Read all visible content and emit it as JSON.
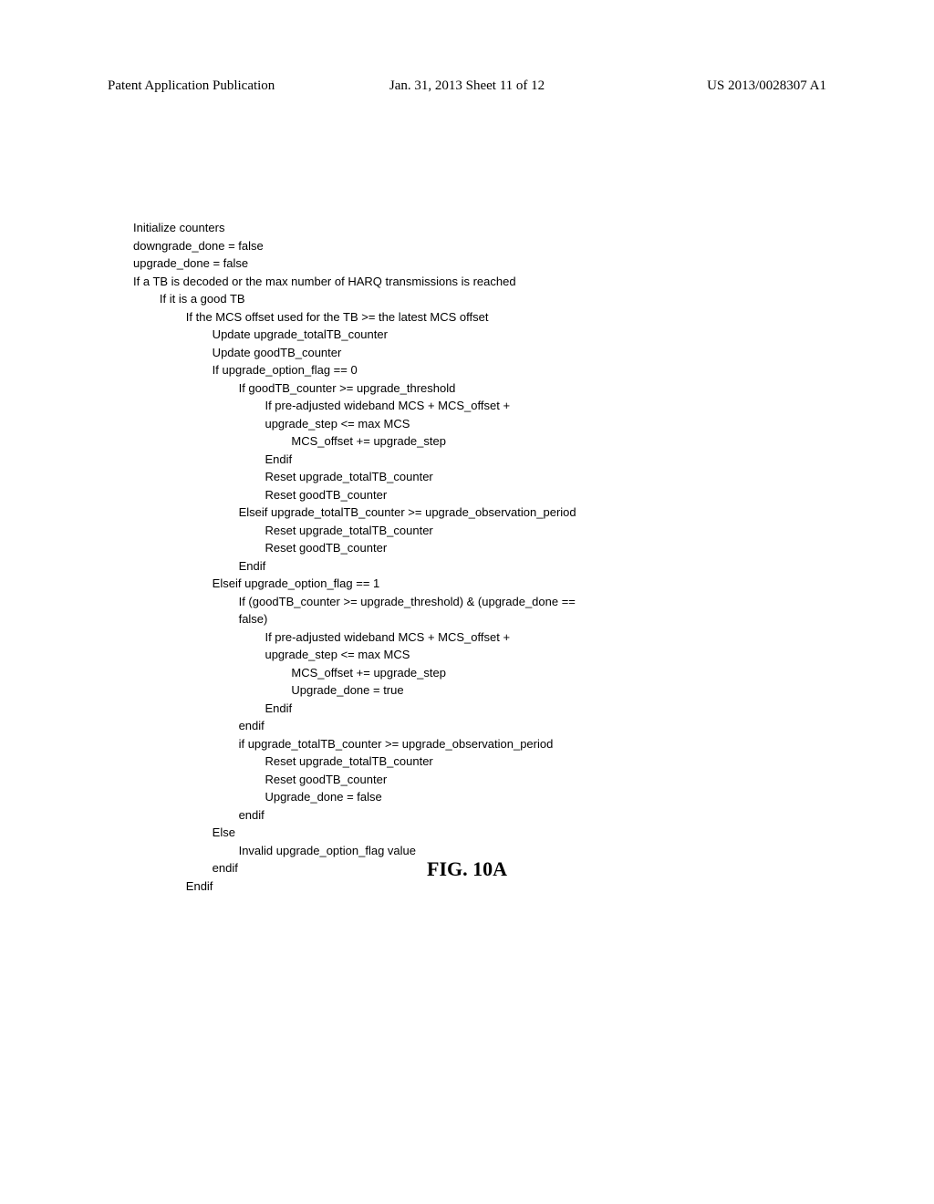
{
  "header": {
    "left": "Patent Application Publication",
    "center": "Jan. 31, 2013  Sheet 11 of 12",
    "right": "US 2013/0028307 A1"
  },
  "code": {
    "lines": [
      "Initialize counters",
      "downgrade_done = false",
      "upgrade_done = false",
      "If a TB is decoded or the max number of HARQ transmissions is reached",
      "        If it is a good TB",
      "                If the MCS offset used for the TB >= the latest MCS offset",
      "                        Update upgrade_totalTB_counter",
      "                        Update goodTB_counter",
      "                        If upgrade_option_flag == 0",
      "                                If goodTB_counter >= upgrade_threshold",
      "                                        If pre-adjusted wideband MCS + MCS_offset +",
      "                                        upgrade_step <= max MCS",
      "                                                MCS_offset += upgrade_step",
      "                                        Endif",
      "                                        Reset upgrade_totalTB_counter",
      "                                        Reset goodTB_counter",
      "                                Elseif upgrade_totalTB_counter >= upgrade_observation_period",
      "                                        Reset upgrade_totalTB_counter",
      "                                        Reset goodTB_counter",
      "                                Endif",
      "                        Elseif upgrade_option_flag == 1",
      "                                If (goodTB_counter >= upgrade_threshold) & (upgrade_done ==",
      "                                false)",
      "                                        If pre-adjusted wideband MCS + MCS_offset +",
      "                                        upgrade_step <= max MCS",
      "                                                MCS_offset += upgrade_step",
      "                                                Upgrade_done = true",
      "                                        Endif",
      "                                endif",
      "                                if upgrade_totalTB_counter >= upgrade_observation_period",
      "                                        Reset upgrade_totalTB_counter",
      "                                        Reset goodTB_counter",
      "                                        Upgrade_done = false",
      "                                endif",
      "                        Else",
      "                                Invalid upgrade_option_flag value",
      "                        endif",
      "                Endif"
    ]
  },
  "figure": {
    "caption": "FIG. 10A"
  }
}
